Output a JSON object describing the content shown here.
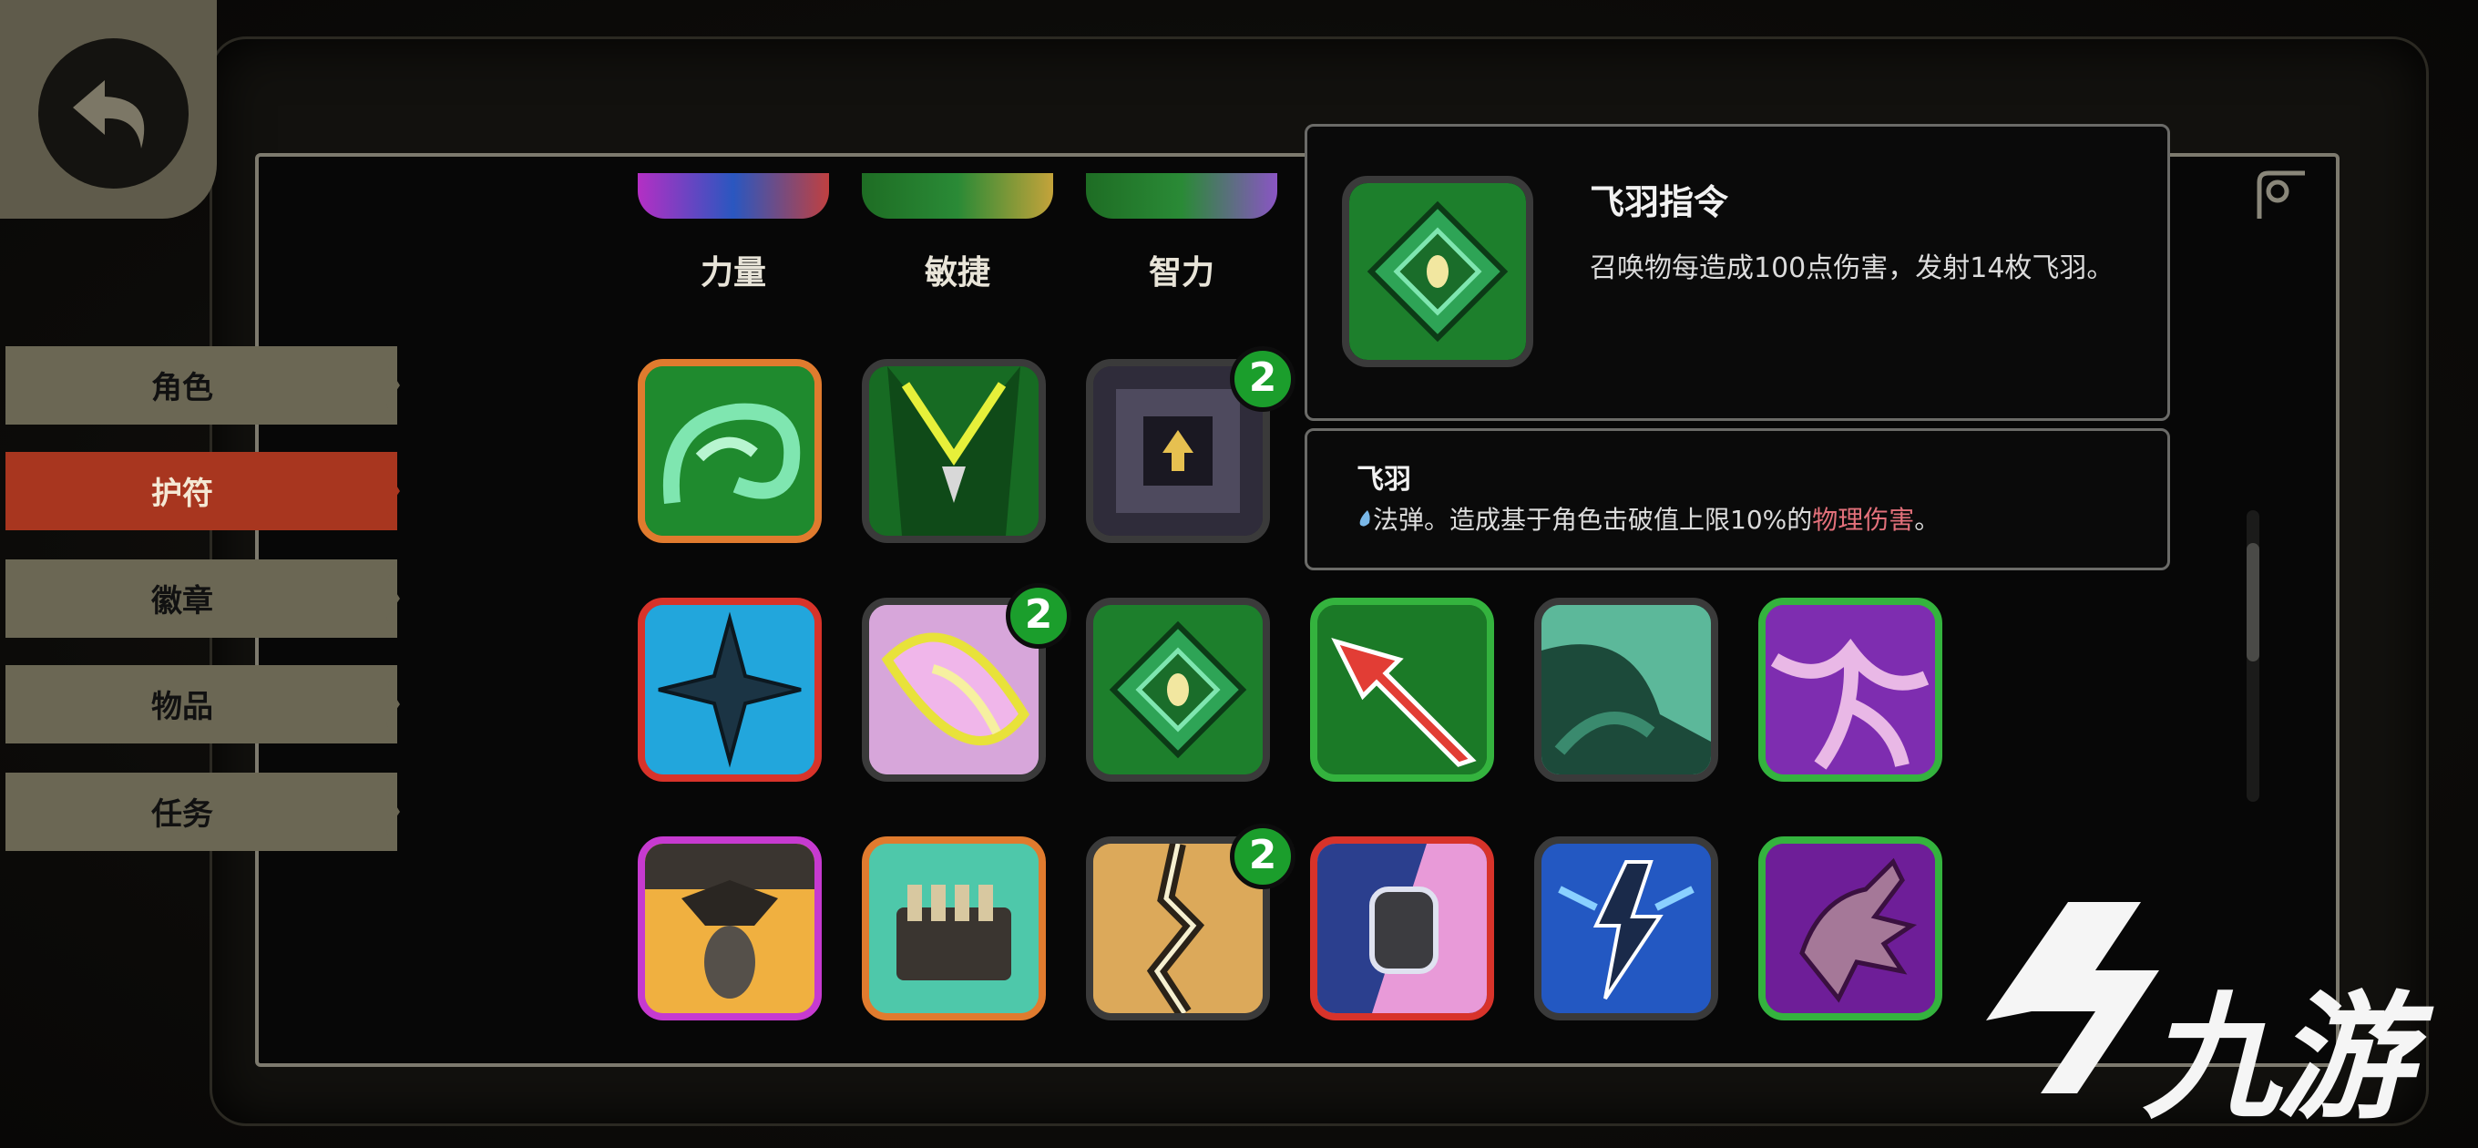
{
  "sidebar": {
    "tabs": [
      {
        "label": "角色",
        "active": false
      },
      {
        "label": "护符",
        "active": true
      },
      {
        "label": "徽章",
        "active": false
      },
      {
        "label": "物品",
        "active": false
      },
      {
        "label": "任务",
        "active": false
      }
    ]
  },
  "stats": [
    {
      "label": "力量"
    },
    {
      "label": "敏捷"
    },
    {
      "label": "智力"
    }
  ],
  "grid": {
    "rows": [
      [
        {
          "icon": "green-vortex-icon",
          "border": "#e07b2e"
        },
        {
          "icon": "green-cloak-icon",
          "border": "#3a3a3a"
        },
        {
          "icon": "stone-portal-icon",
          "border": "#3a3a3a",
          "badge": "2"
        }
      ],
      [
        {
          "icon": "blue-star-icon",
          "border": "#d8332a"
        },
        {
          "icon": "pink-feather-icon",
          "border": "#3a3a3a",
          "badge": "2"
        },
        {
          "icon": "green-diamond-eye-icon",
          "border": "#3a3a3a"
        },
        {
          "icon": "red-arrow-icon",
          "border": "#34b33e"
        },
        {
          "icon": "teal-claw-icon",
          "border": "#3a3a3a"
        },
        {
          "icon": "purple-web-icon",
          "border": "#34b33e"
        }
      ],
      [
        {
          "icon": "bomb-drop-icon",
          "border": "#c63ad0"
        },
        {
          "icon": "bullet-rack-icon",
          "border": "#e07b2e"
        },
        {
          "icon": "cracked-ground-icon",
          "border": "#3a3a3a",
          "badge": "2"
        },
        {
          "icon": "fist-lightning-icon",
          "border": "#d8332a"
        },
        {
          "icon": "blue-lightning-icon",
          "border": "#3a3a3a"
        },
        {
          "icon": "purple-hand-icon",
          "border": "#34b33e"
        }
      ]
    ]
  },
  "tooltip": {
    "title": "飞羽指令",
    "description": "召唤物每造成100点伤害，发射14枚飞羽。",
    "sub_title": "飞羽",
    "sub_desc_prefix": "法弹。造成基于角色击破值上限10%的",
    "sub_desc_highlight": "物理伤害",
    "sub_desc_suffix": "。"
  },
  "watermark": {
    "text": "九游"
  },
  "colors": {
    "active_tab": "#a8361f",
    "inactive_tab": "#6b6754",
    "badge": "#1b9e2c",
    "damage_highlight": "#e2707a"
  }
}
